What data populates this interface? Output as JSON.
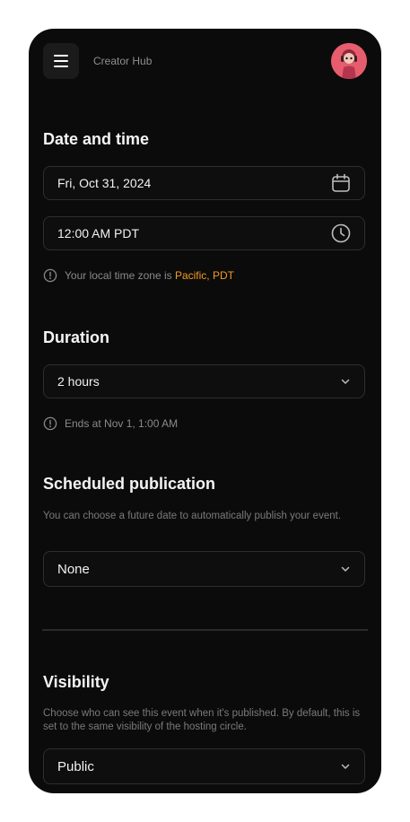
{
  "header": {
    "app_title": "Creator Hub",
    "menu_icon": "hamburger-menu-icon",
    "avatar": "user-avatar"
  },
  "date_time": {
    "title": "Date and time",
    "date_value": "Fri, Oct 31, 2024",
    "date_icon": "calendar-icon",
    "time_value": "12:00 AM PDT",
    "time_icon": "clock-icon",
    "timezone_hint_prefix": "Your local time zone is ",
    "timezone_hint_value": "Pacific, PDT"
  },
  "duration": {
    "title": "Duration",
    "value": "2 hours",
    "hint": "Ends at Nov 1, 1:00 AM"
  },
  "scheduled_publication": {
    "title": "Scheduled publication",
    "description": "You can choose a future date to automatically publish your event.",
    "value": "None"
  },
  "visibility": {
    "title": "Visibility",
    "description": "Choose who can see this event when it's published. By default, this is set to the same visibility of the hosting circle.",
    "value": "Public"
  },
  "colors": {
    "background": "#0b0b0b",
    "accent": "#f39a21",
    "field_border": "#2e2e2e"
  }
}
